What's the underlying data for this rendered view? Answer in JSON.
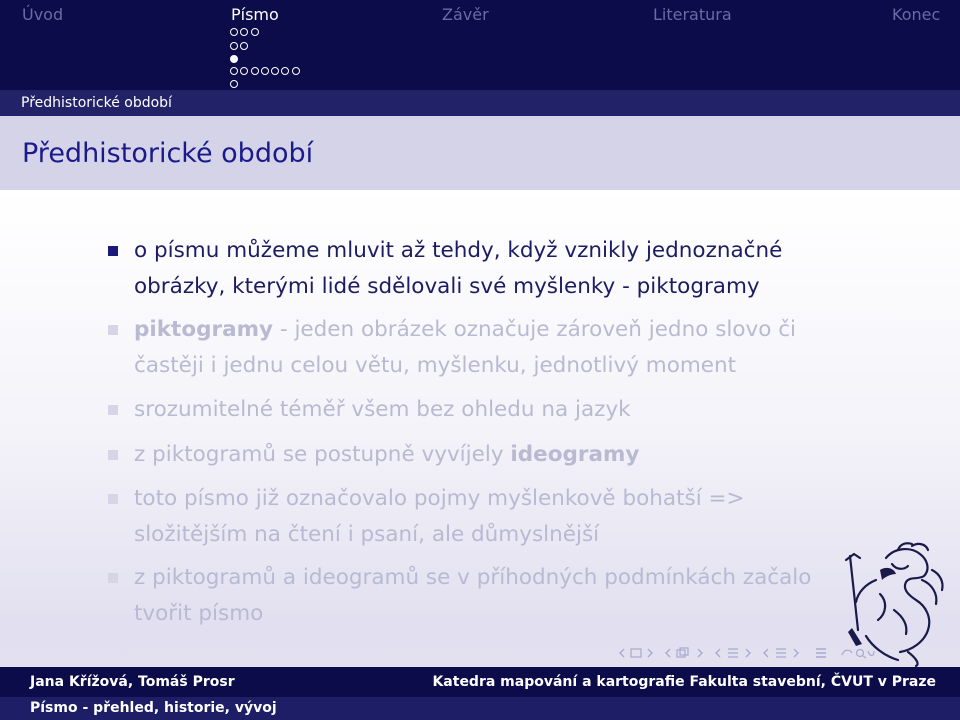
{
  "nav": {
    "sections": [
      {
        "label": "Úvod",
        "active": false
      },
      {
        "label": "Písmo",
        "active": true
      },
      {
        "label": "Závěr",
        "active": false
      },
      {
        "label": "Literatura",
        "active": false
      },
      {
        "label": "Konec",
        "active": false
      }
    ]
  },
  "subsection": "Předhistorické období",
  "frame": {
    "title": "Předhistorické období"
  },
  "items": [
    {
      "line1": "o písmu můžeme mluvit až tehdy, když vznikly jednoznačné",
      "line2": "obrázky, kterými lidé sdělovali své myšlenky - piktogramy"
    },
    {
      "kw": "piktogramy",
      "rest": " - jeden obrázek označuje zároveň jedno slovo či",
      "line2": "častěji i jednu celou větu, myšlenku, jednotlivý moment"
    },
    {
      "line1": "srozumitelné téměř všem bez ohledu na jazyk"
    },
    {
      "pre": "z piktogramů se postupně vyvíjely ",
      "kw": "ideogramy"
    },
    {
      "line1": "toto písmo již označovalo pojmy myšlenkově bohatší =>",
      "line2": "složitějším na čtení i psaní, ale důmyslnější"
    },
    {
      "line1": "z piktogramů a ideogramů se v příhodných podmínkách začalo",
      "line2": "tvořit písmo"
    }
  ],
  "footer": {
    "authors": "Jana Křížová, Tomáš Prosr",
    "institution": "Katedra mapování a kartografie  Fakulta stavební, ČVUT v Praze",
    "talk_title": "Písmo - přehled, historie, vývoj"
  },
  "colors": {
    "nav_bg": "#0c0c4a",
    "title_color": "#1a1a8c",
    "text_color": "#1c1c60",
    "faded_text": "#b9b9d2"
  },
  "icons": [
    "arrow-left-icon",
    "frame-icon",
    "arrow-right-icon",
    "section-icon",
    "subsection-icon",
    "align-icon",
    "search-icon"
  ]
}
